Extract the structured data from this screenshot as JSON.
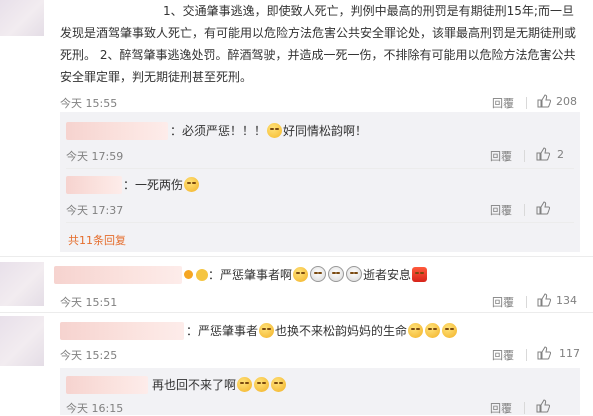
{
  "comments": [
    {
      "lines": [
        "1、交通肇事逃逸，即使致人死亡，判例中最高的刑罚是有期徒刑15年;而一旦",
        "发现是酒驾肇事致人死亡，有可能用以危险方法危害公共安全罪论处，该罪最高刑罚是无期徒刑或",
        "死刑。 2、醉驾肇事逃逸处罚。醉酒驾驶，并造成一死一伤，不排除有可能用以危险方法危害公共",
        "安全罪定罪，判无期徒刑甚至死刑。"
      ],
      "time": "今天 15:55",
      "reply": "回覆",
      "likes": "208",
      "replies": [
        {
          "text_a": "：必须严惩！！！",
          "text_b": "好同情松韵啊！",
          "time": "今天 17:59",
          "reply": "回覆",
          "likes": "2"
        },
        {
          "text_a": "：一死两伤",
          "time": "今天 17:37",
          "reply": "回覆",
          "likes": ""
        }
      ],
      "more": "共11条回复"
    },
    {
      "text_a": "：严惩肇事者啊",
      "text_b": "逝者安息",
      "time": "今天 15:51",
      "reply": "回覆",
      "likes": "134"
    },
    {
      "text_a": "：严惩肇事者",
      "text_b": "也换不来松韵妈妈的生命",
      "time": "今天 15:25",
      "reply": "回覆",
      "likes": "117"
    },
    {
      "text_a": "再也回不来了啊",
      "time": "今天 16:15",
      "reply": "回覆",
      "likes": ""
    }
  ],
  "icons": {
    "like": "thumbs-up-icon",
    "emoji": "face-emoji-icon"
  },
  "colors": {
    "more_link": "#e56d2c",
    "meta_gray": "#808080",
    "name_blur": "#f9d8d4"
  }
}
